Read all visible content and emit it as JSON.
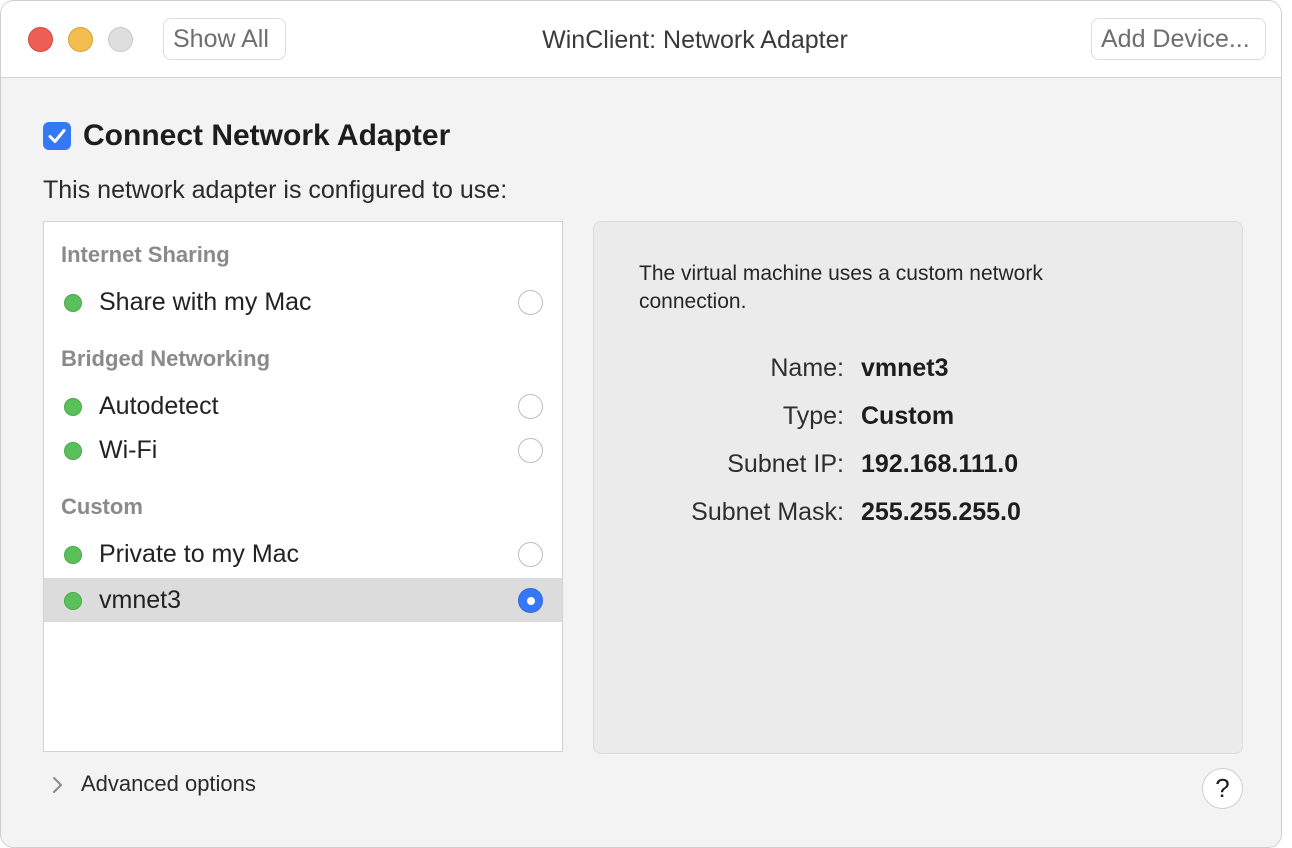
{
  "window": {
    "title": "WinClient: Network Adapter",
    "show_all_label": "Show All",
    "add_device_label": "Add Device..."
  },
  "connect": {
    "label": "Connect Network Adapter",
    "checked": true
  },
  "config_label": "This network adapter is configured to use:",
  "list": {
    "groups": [
      {
        "header": "Internet Sharing",
        "items": [
          {
            "label": "Share with my Mac",
            "selected": false
          }
        ]
      },
      {
        "header": "Bridged Networking",
        "items": [
          {
            "label": "Autodetect",
            "selected": false
          },
          {
            "label": "Wi-Fi",
            "selected": false
          }
        ]
      },
      {
        "header": "Custom",
        "items": [
          {
            "label": "Private to my Mac",
            "selected": false
          },
          {
            "label": "vmnet3",
            "selected": true
          }
        ]
      }
    ]
  },
  "info": {
    "description": "The virtual machine uses a custom network connection.",
    "fields": [
      {
        "key": "Name:",
        "value": "vmnet3"
      },
      {
        "key": "Type:",
        "value": "Custom"
      },
      {
        "key": "Subnet IP:",
        "value": "192.168.111.0"
      },
      {
        "key": "Subnet Mask:",
        "value": "255.255.255.0"
      }
    ]
  },
  "advanced_label": "Advanced options",
  "help_label": "?",
  "colors": {
    "accent": "#3478f6",
    "status_dot": "#5ac05a",
    "selected_row": "#dcdcdc"
  }
}
